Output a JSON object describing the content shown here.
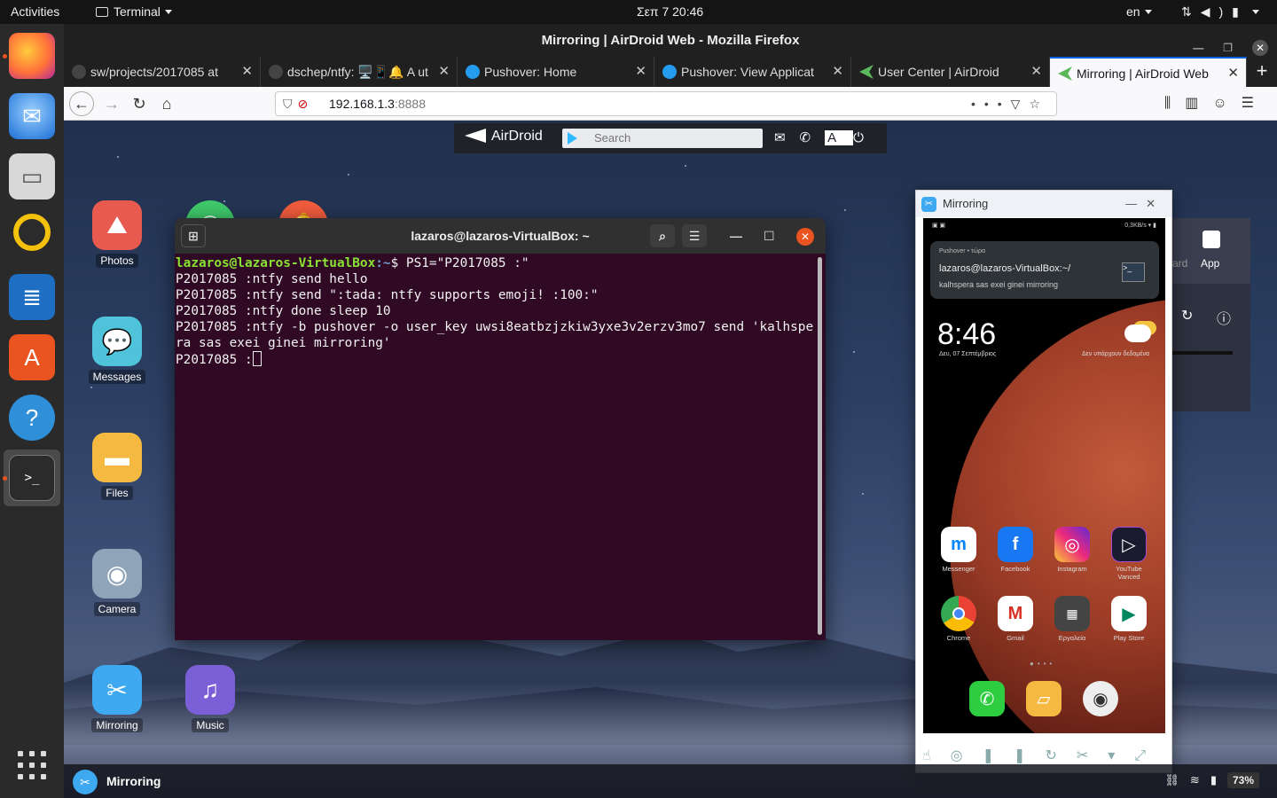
{
  "topbar": {
    "activities": "Activities",
    "app_menu": "Terminal",
    "clock": "Σεπ 7  20:46",
    "language": "en",
    "tray_icons": [
      "network-icon",
      "volume-icon",
      "power-icon"
    ]
  },
  "dock": {
    "items": [
      "firefox-icon",
      "thunderbird-icon",
      "files-icon",
      "rhythmbox-icon",
      "writer-icon",
      "software-icon",
      "help-icon",
      "terminal-icon"
    ],
    "show_apps": "grid-icon"
  },
  "firefox": {
    "title": "Mirroring | AirDroid Web - Mozilla Firefox",
    "tabs": [
      {
        "label": "sw/projects/2017085 at",
        "favicon": "github"
      },
      {
        "label": "dschep/ntfy: 🖥️📱🔔 A ut",
        "favicon": "github"
      },
      {
        "label": "Pushover: Home",
        "favicon": "pushover"
      },
      {
        "label": "Pushover: View Applicat",
        "favicon": "pushover"
      },
      {
        "label": "User Center | AirDroid",
        "favicon": "airdroid"
      },
      {
        "label": "Mirroring | AirDroid Web",
        "favicon": "airdroid"
      }
    ],
    "url": "192.168.1.3",
    "url_port": ":8888"
  },
  "airdroid": {
    "logo": "AirDroid",
    "search_placeholder": "Search",
    "toolbar_icons": [
      "mail-icon",
      "phone-icon",
      "text-icon",
      "power-icon"
    ]
  },
  "desktop_apps": [
    {
      "label": "Photos",
      "color": "#e85a4f"
    },
    {
      "label": "Messages",
      "color": "#4fc3d9"
    },
    {
      "label": "Files",
      "color": "#f5b942"
    },
    {
      "label": "Camera",
      "color": "#8fa4b8"
    },
    {
      "label": "Mirroring",
      "color": "#3ea8f0"
    },
    {
      "label": "Music",
      "color": "#7b5fd6"
    }
  ],
  "terminal": {
    "title": "lazaros@lazaros-VirtualBox: ~",
    "prompt_user": "lazaros@lazaros-VirtualBox",
    "prompt_path": ":~",
    "first_cmd": "$ PS1=\"P2017085 :\"",
    "lines": [
      "P2017085 :ntfy send hello",
      "P2017085 :ntfy send \":tada: ntfy supports emoji! :100:\"",
      "P2017085 :ntfy done sleep 10",
      "P2017085 :ntfy -b pushover -o user_key uwsi8eatbzjzkiw3yxe3v2erzv3mo7 send 'kalhspera sas exei ginei mirroring'"
    ],
    "current_prompt": "P2017085 :"
  },
  "mirroring": {
    "title": "Mirroring",
    "status_right": "0,3KB/s",
    "notification": {
      "app": "Pushover • τώρα",
      "title": "lazaros@lazaros-VirtualBox:~/",
      "body": "kalhspera sas exei ginei mirroring"
    },
    "clock": "8:46",
    "date": "Δευ, 07 Σεπτέμβριος",
    "weather": "Δεν υπάρχουν δεδομένα",
    "apps": [
      {
        "label": "Messenger",
        "color": "#ffffff",
        "glyph": "m"
      },
      {
        "label": "Facebook",
        "color": "#1877f2",
        "glyph": "f"
      },
      {
        "label": "Instagram",
        "color": "#c13584",
        "glyph": "◎"
      },
      {
        "label": "YouTube Vanced",
        "color": "#222222",
        "glyph": "▷"
      },
      {
        "label": "Chrome",
        "color": "#e8e8e8",
        "glyph": "●"
      },
      {
        "label": "Gmail",
        "color": "#ffffff",
        "glyph": "M"
      },
      {
        "label": "Εργαλεία",
        "color": "#555555",
        "glyph": "▦"
      },
      {
        "label": "Play Store",
        "color": "#ffffff",
        "glyph": "▶"
      }
    ],
    "dock_apps": [
      "phone-icon",
      "notes-icon",
      "camera-icon"
    ]
  },
  "panel_behind": {
    "app_label": "App",
    "partial_label": "ard"
  },
  "taskbar": {
    "active_app": "Mirroring",
    "battery": "73%"
  }
}
